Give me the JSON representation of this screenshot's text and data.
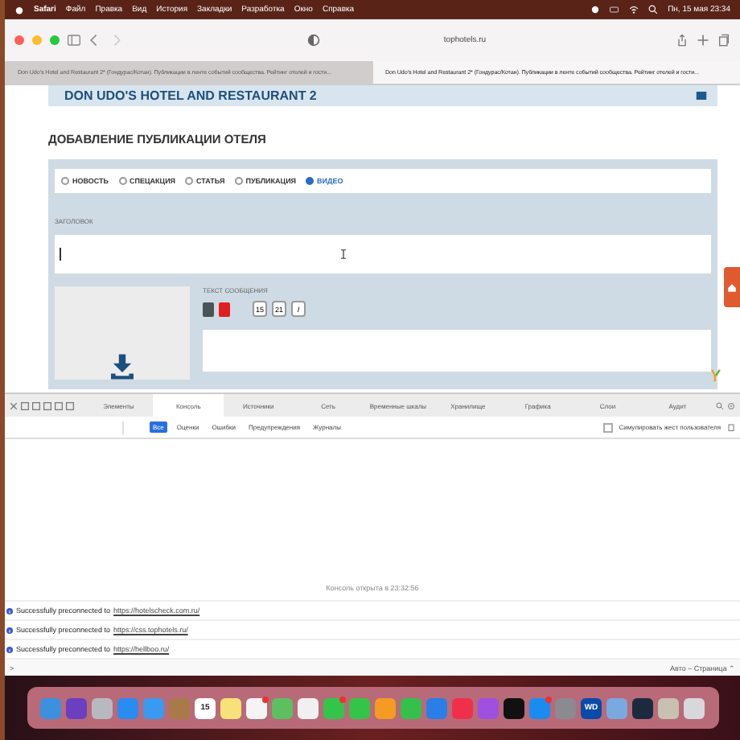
{
  "menu_bar": {
    "app": "Safari",
    "items": [
      "Файл",
      "Правка",
      "Вид",
      "История",
      "Закладки",
      "Разработка",
      "Окно",
      "Справка"
    ],
    "clock": "Пн, 15 мая  23:34"
  },
  "toolbar": {
    "address": "tophotels.ru"
  },
  "tabs": [
    {
      "title": "Don Udo's Hotel and Restaurant 2* (Гондурас/Котан). Публикации в ленте событий сообщества. Рейтинг отелей и гости...",
      "selected": false
    },
    {
      "title": "Don Udo's Hotel and Restaurant 2* (Гондурас/Котан). Публикации в ленте событий сообщества. Рейтинг отелей и гости...",
      "selected": true
    }
  ],
  "page": {
    "hotel_name": "DON UDO'S HOTEL AND RESTAURANT 2",
    "heading": "ДОБАВЛЕНИЕ ПУБЛИКАЦИИ ОТЕЛЯ",
    "post_types": [
      {
        "label": "НОВОСТЬ",
        "selected": false
      },
      {
        "label": "СПЕЦАКЦИЯ",
        "selected": false
      },
      {
        "label": "СТАТЬЯ",
        "selected": false
      },
      {
        "label": "ПУБЛИКАЦИЯ",
        "selected": false
      },
      {
        "label": "ВИДЕО",
        "selected": true
      }
    ],
    "title_label": "ЗАГОЛОВОК",
    "text_label": "ТЕКСТ СООБЩЕНИЯ",
    "colors": [
      {
        "color": "#4a5358"
      },
      {
        "color": "#e02020"
      }
    ],
    "format_buttons": [
      "15",
      "21",
      "I"
    ]
  },
  "devtools": {
    "tabs": [
      {
        "label": "Элементы",
        "selected": false
      },
      {
        "label": "Консоль",
        "selected": true
      },
      {
        "label": "Источники",
        "selected": false
      },
      {
        "label": "Сеть",
        "selected": false
      },
      {
        "label": "Временные шкалы",
        "selected": false
      },
      {
        "label": "Хранилище",
        "selected": false
      },
      {
        "label": "Графика",
        "selected": false
      },
      {
        "label": "Слои",
        "selected": false
      },
      {
        "label": "Аудит",
        "selected": false
      }
    ],
    "filters": [
      {
        "label": "Все",
        "selected": true
      },
      {
        "label": "Оценки",
        "selected": false
      },
      {
        "label": "Ошибки",
        "selected": false
      },
      {
        "label": "Предупреждения",
        "selected": false
      },
      {
        "label": "Журналы",
        "selected": false
      }
    ],
    "simulate_gesture": {
      "label": "Симулировать жест пользователя",
      "checked": false
    },
    "opened_note": "Консоль открыта в 23:32:56",
    "messages": [
      {
        "text": "Successfully preconnected to",
        "link": "https://hotelscheck.com.ru/"
      },
      {
        "text": "Successfully preconnected to",
        "link": "https://css.tophotels.ru/"
      },
      {
        "text": "Successfully preconnected to",
        "link": "https://hellboo.ru/"
      }
    ],
    "prompt": ">",
    "context": "Авто – Страница ⌃"
  },
  "dock": [
    {
      "color": "#3d8fe0"
    },
    {
      "color": "#6a3fc0"
    },
    {
      "color": "#b8b8c0"
    },
    {
      "color": "#2a8cf0"
    },
    {
      "color": "#3a9af0"
    },
    {
      "color": "#a87a4a"
    },
    {
      "color": "#ffffff",
      "label": "15"
    },
    {
      "color": "#f7e27a"
    },
    {
      "color": "#f4f4f4",
      "badge": true
    },
    {
      "color": "#5cc060"
    },
    {
      "color": "#f0f0f0"
    },
    {
      "color": "#35c44a",
      "badge": true
    },
    {
      "color": "#35c44a"
    },
    {
      "color": "#f59a22"
    },
    {
      "color": "#34c04a"
    },
    {
      "color": "#2a7ee8"
    },
    {
      "color": "#f0304a"
    },
    {
      "color": "#a050e0"
    },
    {
      "color": "#111111"
    },
    {
      "color": "#1a8cf0",
      "badge": true
    },
    {
      "color": "#8a8a90"
    },
    {
      "color": "#0a4aa8",
      "label": "WD"
    },
    {
      "color": "#7aa8e0"
    },
    {
      "color": "#1c2a40"
    },
    {
      "color": "#c8c0b0"
    },
    {
      "color": "#d8d8dc"
    }
  ]
}
